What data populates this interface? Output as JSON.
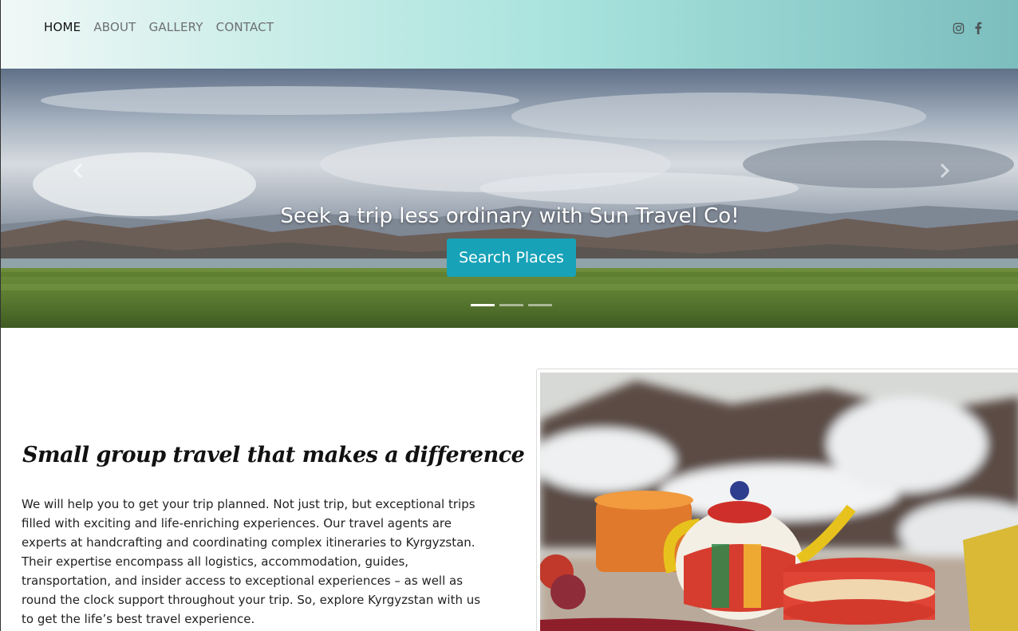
{
  "nav": {
    "items": [
      {
        "label": "HOME",
        "active": true
      },
      {
        "label": "ABOUT",
        "active": false
      },
      {
        "label": "GALLERY",
        "active": false
      },
      {
        "label": "CONTACT",
        "active": false
      }
    ],
    "social": [
      "instagram-icon",
      "facebook-icon"
    ]
  },
  "hero": {
    "caption": "Seek a trip less ordinary with Sun Travel Co!",
    "button_label": "Search Places",
    "slides_count": 3,
    "active_slide": 1,
    "button_color": "#17a2b8"
  },
  "content": {
    "headline": "Small group travel that makes a difference",
    "paragraph": "We will help you to get your trip planned. Not just trip, but exceptional trips filled with exciting and life-enriching experiences. Our travel agents are experts at handcrafting and coordinating complex itineraries to Kyrgyzstan. Their expertise encompass all logistics, accommodation, guides, transportation, and insider access to exceptional experiences – as well as round the clock support throughout your trip. So, explore Kyrgyzstan with us to get the life’s best travel experience."
  }
}
